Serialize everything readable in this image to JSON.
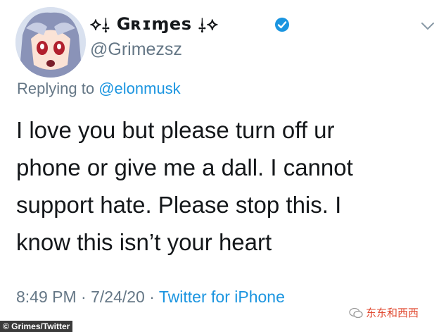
{
  "tweet": {
    "display_name": "⟡⸸ Gʀɪɱes ⸸⟡",
    "handle": "@Grimezsz",
    "replying_prefix": "Replying to ",
    "replying_to": "@elonmusk",
    "text": "I love you but please turn off ur\nphone or give me a dall.  I cannot\nsupport hate.  Please stop this. I\nknow this isn’t your heart",
    "time": "8:49 PM",
    "date": "7/24/20",
    "source": "Twitter for iPhone",
    "separator": "·"
  },
  "overlay": {
    "watermark": "东东和西西",
    "photo_credit": "© Grimes/Twitter"
  },
  "colors": {
    "accent": "#1b95e0",
    "muted": "#657786",
    "text": "#14171a",
    "watermark": "#e0472e"
  },
  "icons": {
    "verified": "verified-badge-icon",
    "more": "chevron-down-icon",
    "watermark": "wechat-icon"
  }
}
